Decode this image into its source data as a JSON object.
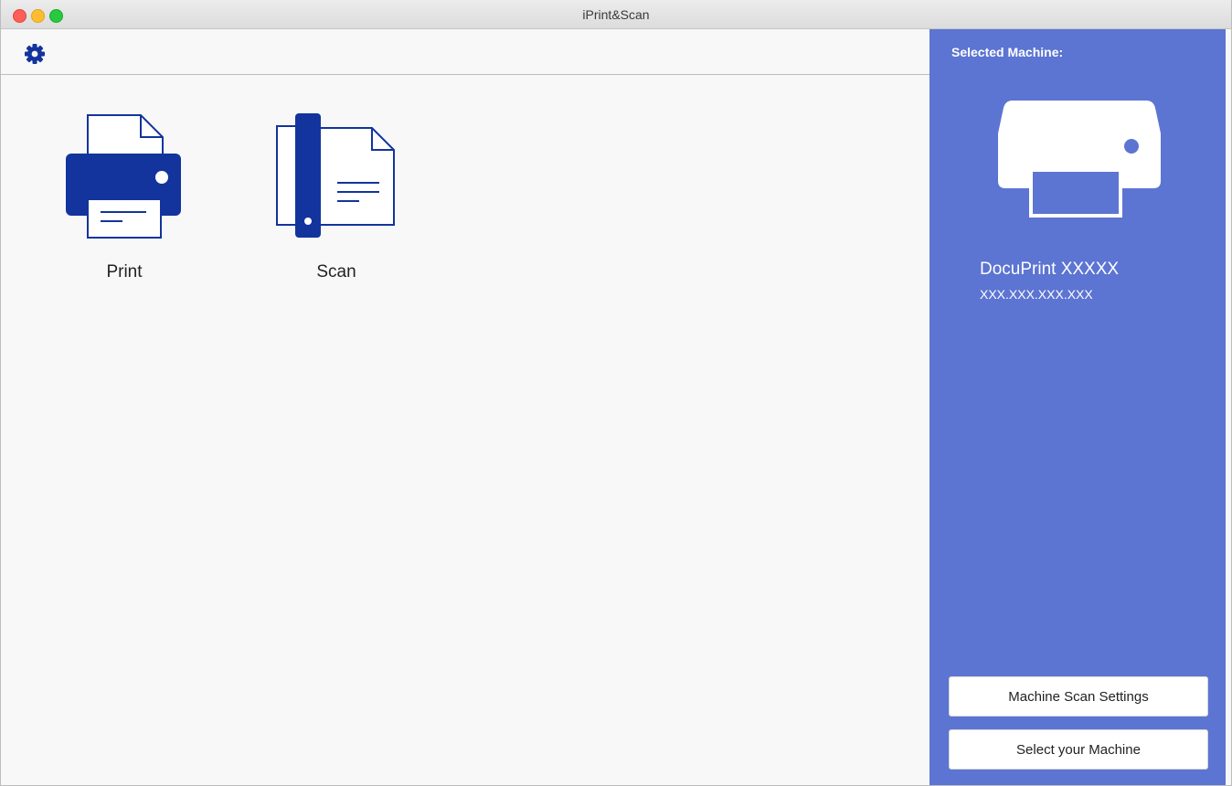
{
  "window": {
    "title": "iPrint&Scan"
  },
  "toolbar": {
    "settings_icon": "gear-icon"
  },
  "functions": [
    {
      "label": "Print",
      "icon": "printer-icon"
    },
    {
      "label": "Scan",
      "icon": "scanner-icon"
    }
  ],
  "side_panel": {
    "heading": "Selected Machine:",
    "machine_icon": "printer-icon",
    "machine_name": "DocuPrint XXXXX",
    "machine_ip": "XXX.XXX.XXX.XXX",
    "buttons": {
      "scan_settings": "Machine Scan Settings",
      "select_machine": "Select your Machine"
    }
  },
  "colors": {
    "accent": "#13349c",
    "side_panel": "#5c74d2",
    "close": "#fe5f57",
    "minimize": "#febc2e",
    "maximize": "#28c840"
  }
}
